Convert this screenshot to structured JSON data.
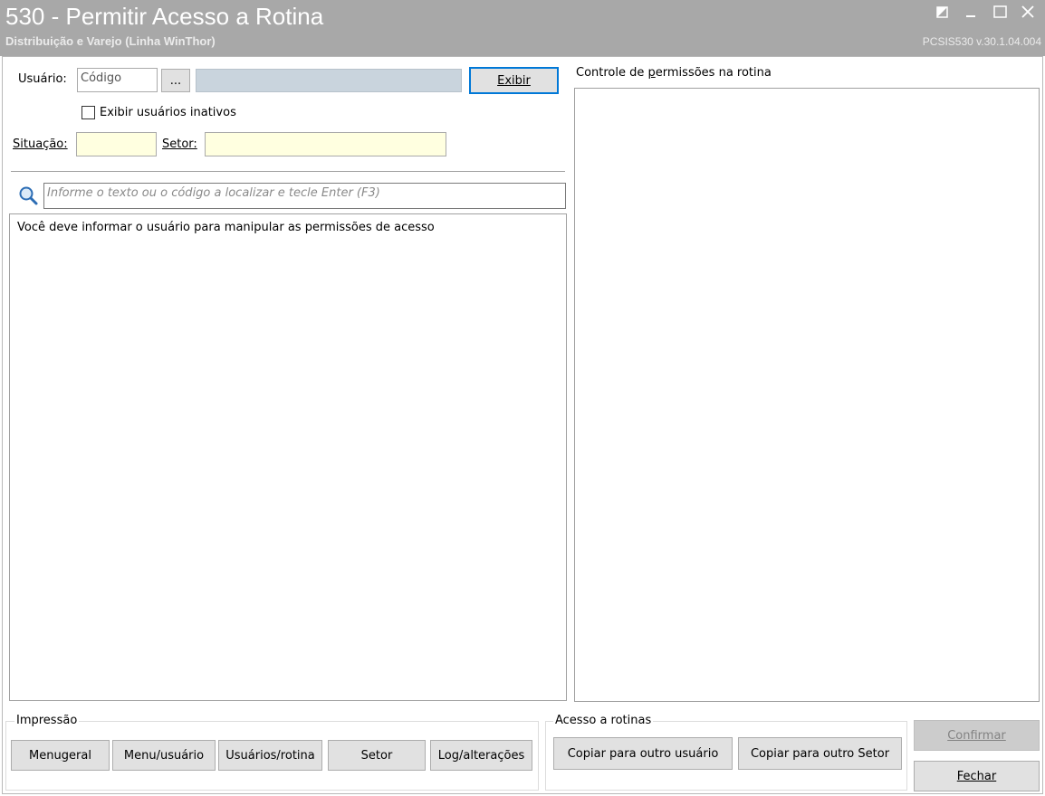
{
  "window": {
    "title": "530 - Permitir Acesso a Rotina",
    "subtitle": "Distribuição e Varejo (Linha WinThor)",
    "version": "PCSIS530  v.30.1.04.004"
  },
  "form": {
    "usuario_label": "Usuário:",
    "usuario_code_placeholder": "Código",
    "ellipsis_label": "...",
    "exibir_label": "Exibir",
    "inativos_label": "Exibir usuários inativos",
    "situacao_label": "Situação:",
    "setor_label": "Setor:"
  },
  "search": {
    "placeholder": "Informe o texto ou o código a localizar e tecle Enter (F3)"
  },
  "tree": {
    "message": "Você deve informar o usuário para manipular as permissões de acesso"
  },
  "permissions": {
    "title": "Controle de permissões na rotina"
  },
  "impressao": {
    "legend": "Impressão",
    "buttons": [
      "Menu geral",
      "Menu/usuário",
      "Usuários/rotina",
      "Setor",
      "Log/alterações"
    ]
  },
  "acesso": {
    "legend": "Acesso a rotinas",
    "copy_user": "Copiar para outro usuário",
    "copy_setor": "Copiar para outro Setor"
  },
  "actions": {
    "confirmar": "Confirmar",
    "fechar": "Fechar"
  }
}
